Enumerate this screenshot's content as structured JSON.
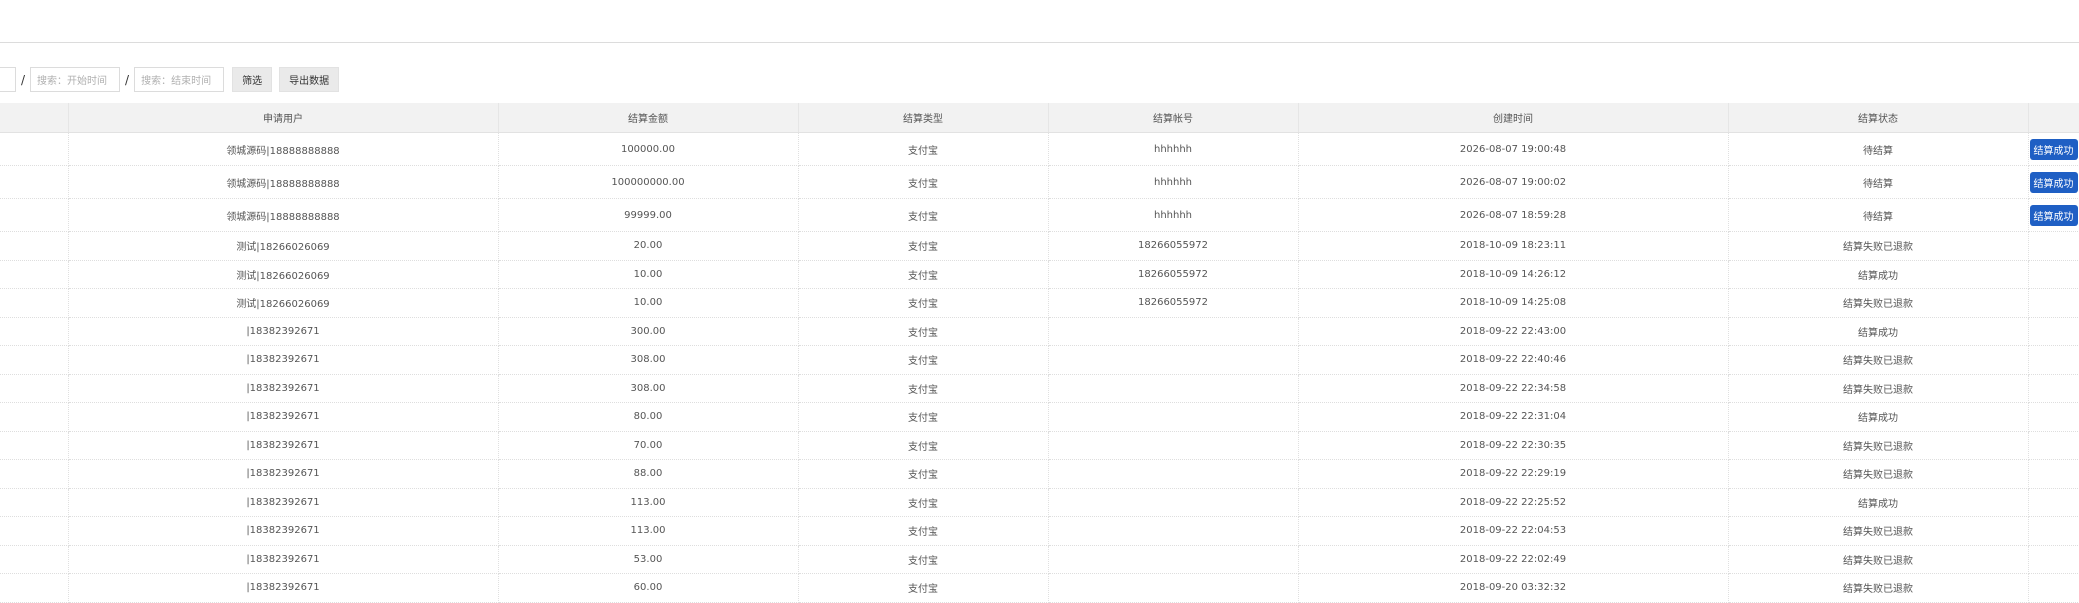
{
  "filter": {
    "start_placeholder": "搜索：开始时间",
    "end_placeholder": "搜索：结束时间",
    "separator": "/",
    "filter_button": "筛选",
    "export_button": "导出数据"
  },
  "table": {
    "columns": [
      "申请用户",
      "结算金额",
      "结算类型",
      "结算帐号",
      "创建时间",
      "结算状态"
    ],
    "operation_label": "结算成功",
    "rows": [
      {
        "user": "领城源码|18888888888",
        "amount": "100000.00",
        "type": "支付宝",
        "account": "hhhhhh",
        "created": "2026-08-07 19:00:48",
        "status": "待结算",
        "status_kind": "pending",
        "has_action": true
      },
      {
        "user": "领城源码|18888888888",
        "amount": "100000000.00",
        "type": "支付宝",
        "account": "hhhhhh",
        "created": "2026-08-07 19:00:02",
        "status": "待结算",
        "status_kind": "pending",
        "has_action": true
      },
      {
        "user": "领城源码|18888888888",
        "amount": "99999.00",
        "type": "支付宝",
        "account": "hhhhhh",
        "created": "2026-08-07 18:59:28",
        "status": "待结算",
        "status_kind": "pending",
        "has_action": true
      },
      {
        "user": "测试|18266026069",
        "amount": "20.00",
        "type": "支付宝",
        "account": "18266055972",
        "created": "2018-10-09 18:23:11",
        "status": "结算失败已退款",
        "status_kind": "failed",
        "has_action": false
      },
      {
        "user": "测试|18266026069",
        "amount": "10.00",
        "type": "支付宝",
        "account": "18266055972",
        "created": "2018-10-09 14:26:12",
        "status": "结算成功",
        "status_kind": "success",
        "has_action": false
      },
      {
        "user": "测试|18266026069",
        "amount": "10.00",
        "type": "支付宝",
        "account": "18266055972",
        "created": "2018-10-09 14:25:08",
        "status": "结算失败已退款",
        "status_kind": "failed",
        "has_action": false
      },
      {
        "user": "|18382392671",
        "amount": "300.00",
        "type": "支付宝",
        "account": "",
        "created": "2018-09-22 22:43:00",
        "status": "结算成功",
        "status_kind": "success",
        "has_action": false
      },
      {
        "user": "|18382392671",
        "amount": "308.00",
        "type": "支付宝",
        "account": "",
        "created": "2018-09-22 22:40:46",
        "status": "结算失败已退款",
        "status_kind": "failed",
        "has_action": false
      },
      {
        "user": "|18382392671",
        "amount": "308.00",
        "type": "支付宝",
        "account": "",
        "created": "2018-09-22 22:34:58",
        "status": "结算失败已退款",
        "status_kind": "failed",
        "has_action": false
      },
      {
        "user": "|18382392671",
        "amount": "80.00",
        "type": "支付宝",
        "account": "",
        "created": "2018-09-22 22:31:04",
        "status": "结算成功",
        "status_kind": "success",
        "has_action": false
      },
      {
        "user": "|18382392671",
        "amount": "70.00",
        "type": "支付宝",
        "account": "",
        "created": "2018-09-22 22:30:35",
        "status": "结算失败已退款",
        "status_kind": "failed",
        "has_action": false
      },
      {
        "user": "|18382392671",
        "amount": "88.00",
        "type": "支付宝",
        "account": "",
        "created": "2018-09-22 22:29:19",
        "status": "结算失败已退款",
        "status_kind": "failed",
        "has_action": false
      },
      {
        "user": "|18382392671",
        "amount": "113.00",
        "type": "支付宝",
        "account": "",
        "created": "2018-09-22 22:25:52",
        "status": "结算成功",
        "status_kind": "success",
        "has_action": false
      },
      {
        "user": "|18382392671",
        "amount": "113.00",
        "type": "支付宝",
        "account": "",
        "created": "2018-09-22 22:04:53",
        "status": "结算失败已退款",
        "status_kind": "failed",
        "has_action": false
      },
      {
        "user": "|18382392671",
        "amount": "53.00",
        "type": "支付宝",
        "account": "",
        "created": "2018-09-22 22:02:49",
        "status": "结算失败已退款",
        "status_kind": "failed",
        "has_action": false
      },
      {
        "user": "|18382392671",
        "amount": "60.00",
        "type": "支付宝",
        "account": "",
        "created": "2018-09-20 03:32:32",
        "status": "结算失败已退款",
        "status_kind": "failed",
        "has_action": false
      }
    ]
  },
  "colors": {
    "success_text": "#0a9a2a",
    "action_button": "#1f5fc4",
    "header_bg": "#f2f2f2"
  }
}
